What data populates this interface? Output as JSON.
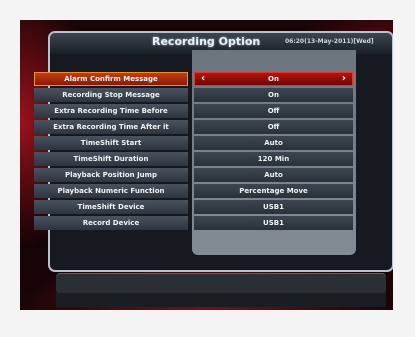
{
  "header": {
    "title": "Recording Option",
    "datetime": "06:20(13-May-2011)[Wed]"
  },
  "menu": {
    "items": [
      {
        "label": "Alarm Confirm Message",
        "value": "On",
        "selected": true
      },
      {
        "label": "Recording Stop Message",
        "value": "On"
      },
      {
        "label": "Extra Recording Time Before",
        "value": "Off"
      },
      {
        "label": "Extra Recording Time After it",
        "value": "Off"
      },
      {
        "label": "TimeShift Start",
        "value": "Auto"
      },
      {
        "label": "TimeShift Duration",
        "value": "120 Min"
      },
      {
        "label": "Playback Position Jump",
        "value": "Auto"
      },
      {
        "label": "Playback Numeric Function",
        "value": "Percentage Move"
      },
      {
        "label": "TimeShift Device",
        "value": "USB1"
      },
      {
        "label": "Record Device",
        "value": "USB1"
      }
    ]
  },
  "icons": {
    "left": "chevron-left-icon",
    "right": "chevron-right-icon"
  },
  "colors": {
    "selected_label": "#c43c12",
    "selected_value": "#b31510"
  }
}
